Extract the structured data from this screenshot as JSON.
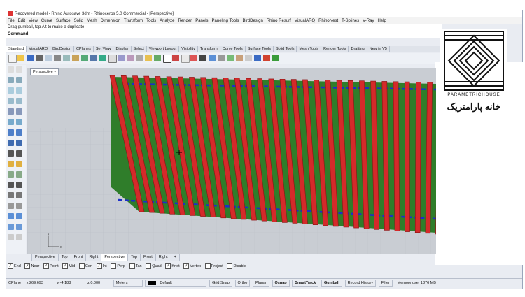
{
  "window": {
    "title": "Recovered model - Rhino Autosave 3dm - Rhinoceros 5.0 Commercial - [Perspective]"
  },
  "menu": [
    "File",
    "Edit",
    "View",
    "Curve",
    "Surface",
    "Solid",
    "Mesh",
    "Dimension",
    "Transform",
    "Tools",
    "Analyze",
    "Render",
    "Panels",
    "Paneling Tools",
    "BirdDesign",
    "Rhino Resurf",
    "VisualARQ",
    "RhinoNest",
    "T-Splines",
    "V-Ray",
    "Help"
  ],
  "command": {
    "history": "Drag gumball, tap Alt to make a duplicate",
    "prompt": "Command:"
  },
  "toolbar_tabs": [
    "Standard",
    "VisualARQ",
    "BirdDesign",
    "CPlanes",
    "Set View",
    "Display",
    "Select",
    "Viewport Layout",
    "Visibility",
    "Transform",
    "Curve Tools",
    "Surface Tools",
    "Solid Tools",
    "Mesh Tools",
    "Render Tools",
    "Drafting",
    "New in V5"
  ],
  "viewport": {
    "label": "Perspective",
    "axis_x": "x",
    "axis_y": "y"
  },
  "viewport_tabs": [
    "Perspective",
    "Top",
    "Front",
    "Right",
    "Perspective",
    "Top",
    "Front",
    "Right",
    "+"
  ],
  "osnaps": [
    {
      "label": "End",
      "on": true
    },
    {
      "label": "Near",
      "on": true
    },
    {
      "label": "Point",
      "on": true
    },
    {
      "label": "Mid",
      "on": true
    },
    {
      "label": "Cen",
      "on": false
    },
    {
      "label": "Int",
      "on": true
    },
    {
      "label": "Perp",
      "on": false
    },
    {
      "label": "Tan",
      "on": false
    },
    {
      "label": "Quad",
      "on": false
    },
    {
      "label": "Knot",
      "on": true
    },
    {
      "label": "Vertex",
      "on": true
    },
    {
      "label": "Project",
      "on": false
    },
    {
      "label": "Disable",
      "on": false
    }
  ],
  "status": {
    "cplane": "CPlane",
    "x": "x 269.693",
    "y": "y -4.188",
    "z": "z 0.000",
    "units": "Meters",
    "layer": "Default",
    "grid_snap": "Grid Snap",
    "ortho": "Ortho",
    "planar": "Planar",
    "osnap": "Osnap",
    "smarttrack": "SmartTrack",
    "gumball": "Gumball",
    "record_history": "Record History",
    "filter": "Filter",
    "memory": "Memory use: 1376 MB"
  },
  "watermark": {
    "latin": "PARAMETRICHOUSE",
    "arabic": "خانه پارامتریک"
  },
  "colors": {
    "surface": "#2f7d2a",
    "fins": "#d42a2a",
    "guide": "#1b2ec8",
    "floor": "#c9cdd3"
  }
}
